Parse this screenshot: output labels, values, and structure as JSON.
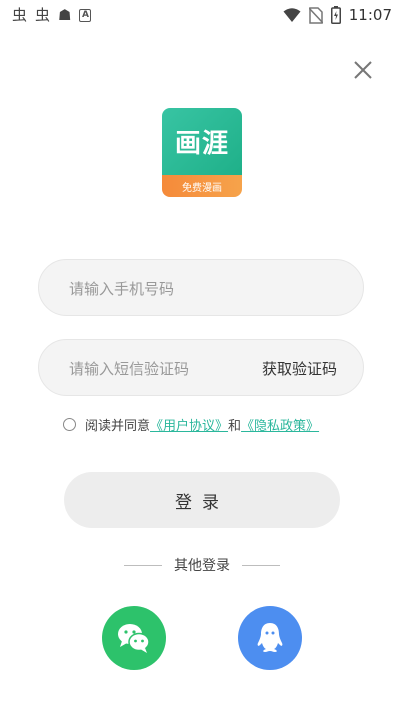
{
  "status_bar": {
    "left_icons": [
      "bug-icon",
      "bug-icon",
      "android-icon",
      "a-icon"
    ],
    "left_glyphs": [
      "虫",
      "虫",
      "☗",
      "A"
    ],
    "time": "11:07"
  },
  "logo": {
    "title": "画涯",
    "subtitle": "免费漫画"
  },
  "phone": {
    "placeholder": "请输入手机号码",
    "value": ""
  },
  "code": {
    "placeholder": "请输入短信验证码",
    "value": "",
    "get_code_label": "获取验证码"
  },
  "agreement": {
    "prefix": "阅读并同意",
    "user_agreement": "《用户协议》",
    "and": "和",
    "privacy_policy": "《隐私政策》",
    "checked": false
  },
  "login_label": "登录",
  "other_login_label": "其他登录",
  "colors": {
    "accent": "#2bb79c",
    "wechat": "#2dc26b",
    "qq": "#4d8ef0",
    "logo_green": "#2bbc97",
    "logo_orange": "#f6923e"
  }
}
